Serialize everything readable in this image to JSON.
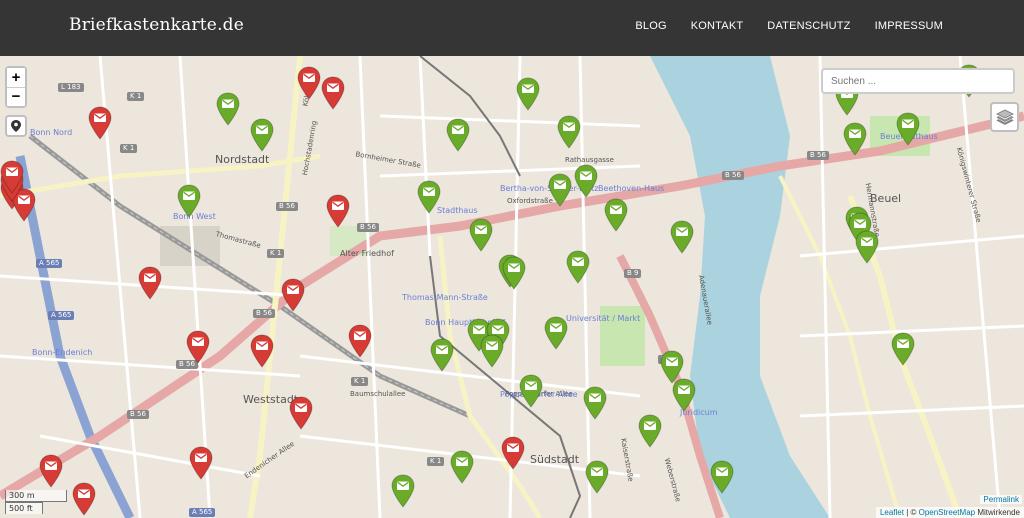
{
  "brand": "Briefkastenkarte.de",
  "nav": [
    "BLOG",
    "KONTAKT",
    "DATENSCHUTZ",
    "IMPRESSUM"
  ],
  "controls": {
    "zoom_in": "+",
    "zoom_out": "−",
    "search_placeholder": "Suchen ...",
    "scale_metric": "300 m",
    "scale_imperial": "500 ft",
    "permalink": "Permalink"
  },
  "attribution": {
    "leaflet": "Leaflet",
    "separator": " | © ",
    "osm": "OpenStreetMap",
    "suffix": " Mitwirkende"
  },
  "marker_colors": {
    "green": "#6aab2a",
    "red": "#d63b35"
  },
  "districts": [
    "Nordstadt",
    "Weststadt",
    "Südstadt",
    "Beuel"
  ],
  "streets": [
    "Oxfordstraße",
    "Hochstadenring",
    "Kölnstraße",
    "Endenicher Allee",
    "Poppelsdorfer Allee",
    "Baumschulallee",
    "Kaiserstraße",
    "Hermannstraße",
    "Königswinterer Straße",
    "Rathausgasse",
    "Thomastraße",
    "Alter Friedhof",
    "Weberstraße",
    "Adenauerallee",
    "Bornheimer Straße"
  ],
  "poi_labels": [
    "Bertha-von-Suttner-Platz",
    "Beethoven-Haus",
    "Stadthaus",
    "Thomas-Mann-Straße",
    "Universität / Markt",
    "Bonn Hauptbahnhof",
    "Bonn-Endenich",
    "Bonn West",
    "Juridicum",
    "Poppelsdorfer Allee",
    "Bonn Nord",
    "Beuel Rathaus"
  ],
  "road_refs": [
    "L 183",
    "K 1",
    "B 56",
    "A 565",
    "B 9"
  ],
  "markers": [
    {
      "color": "red"
    },
    {
      "color": "red"
    },
    {
      "color": "red"
    },
    {
      "color": "green"
    },
    {
      "color": "green"
    },
    {
      "color": "red"
    },
    {
      "color": "red"
    },
    {
      "color": "red"
    },
    {
      "color": "green"
    },
    {
      "color": "green"
    },
    {
      "color": "green"
    },
    {
      "color": "green"
    },
    {
      "color": "green"
    },
    {
      "color": "green"
    },
    {
      "color": "green"
    },
    {
      "color": "red"
    },
    {
      "color": "green"
    },
    {
      "color": "green"
    },
    {
      "color": "green"
    },
    {
      "color": "green"
    },
    {
      "color": "green"
    },
    {
      "color": "red"
    },
    {
      "color": "red"
    },
    {
      "color": "green"
    },
    {
      "color": "green"
    },
    {
      "color": "green"
    },
    {
      "color": "green"
    },
    {
      "color": "green"
    },
    {
      "color": "red"
    },
    {
      "color": "red"
    },
    {
      "color": "green"
    },
    {
      "color": "green"
    },
    {
      "color": "green"
    },
    {
      "color": "green"
    },
    {
      "color": "green"
    },
    {
      "color": "green"
    },
    {
      "color": "red"
    },
    {
      "color": "red"
    },
    {
      "color": "red"
    },
    {
      "color": "green"
    },
    {
      "color": "red"
    },
    {
      "color": "green"
    },
    {
      "color": "green"
    },
    {
      "color": "green"
    },
    {
      "color": "green"
    },
    {
      "color": "red"
    },
    {
      "color": "green"
    },
    {
      "color": "green"
    },
    {
      "color": "green"
    },
    {
      "color": "green"
    },
    {
      "color": "green"
    },
    {
      "color": "green"
    },
    {
      "color": "green"
    },
    {
      "color": "red"
    },
    {
      "color": "red"
    }
  ]
}
